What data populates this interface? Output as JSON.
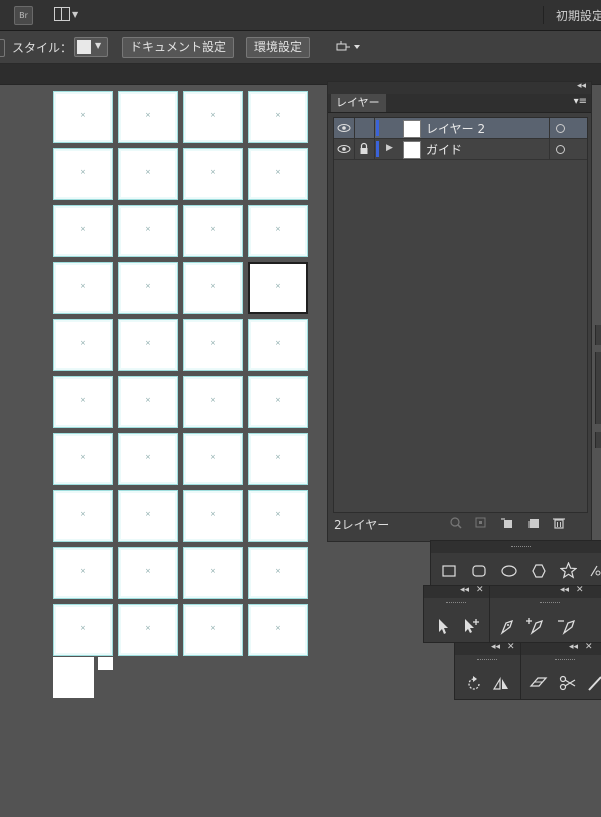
{
  "app_bar": {
    "bridge_label": "Br",
    "workspace_label": "初期設定"
  },
  "control_bar": {
    "style_label": "スタイル：",
    "document_setup": "ドキュメント設定",
    "preferences": "環境設定"
  },
  "artboards": {
    "rows": 10,
    "cols": 4,
    "selected_cell": [
      3,
      3
    ]
  },
  "layers_panel": {
    "tab": "レイヤー",
    "rows": [
      {
        "name": "レイヤー 2",
        "selected": true,
        "locked": false,
        "expandable": false
      },
      {
        "name": "ガイド",
        "selected": false,
        "locked": true,
        "expandable": true
      }
    ],
    "count_label": "2レイヤー",
    "layer_color": "#3b63d9"
  },
  "colors": {
    "background": "#535353",
    "panel": "#3e3e3e",
    "selection": "#5a6370"
  }
}
